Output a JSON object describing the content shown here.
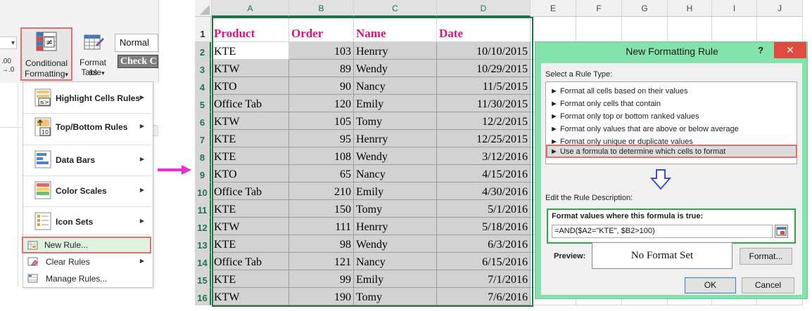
{
  "ribbon": {
    "cf_label_1": "Conditional",
    "cf_label_2": "Formatting",
    "fat_label_1": "Format as",
    "fat_label_2": "Table",
    "style_normal": "Normal",
    "style_check": "Check C",
    "dropdown_glyph": "▾",
    "stub_00": ".00",
    "stub_0": "→.0"
  },
  "cf_menu": {
    "items": [
      {
        "label": "Highlight Cells Rules",
        "icon": "highlight-cells-icon"
      },
      {
        "label": "Top/Bottom Rules",
        "icon": "top-bottom-icon"
      },
      {
        "label": "Data Bars",
        "icon": "data-bars-icon"
      },
      {
        "label": "Color Scales",
        "icon": "color-scales-icon"
      },
      {
        "label": "Icon Sets",
        "icon": "icon-sets-icon"
      }
    ],
    "new_rule": "New Rule...",
    "clear_rules": "Clear Rules",
    "manage_rules": "Manage Rules...",
    "submenu_arrow": "▶",
    "icon_text_lt": "≤>",
    "icon_text_10": "10"
  },
  "sheet": {
    "columns": [
      "A",
      "B",
      "C",
      "D",
      "E",
      "F",
      "G",
      "H",
      "I",
      "J"
    ],
    "row_numbers": [
      "1",
      "2",
      "3",
      "4",
      "5",
      "6",
      "7",
      "8",
      "9",
      "10",
      "11",
      "12",
      "13",
      "14",
      "15",
      "16"
    ],
    "headers": [
      "Product",
      "Order",
      "Name",
      "Date"
    ],
    "rows": [
      [
        "KTE",
        "103",
        "Henrry",
        "10/10/2015"
      ],
      [
        "KTW",
        "89",
        "Wendy",
        "10/29/2015"
      ],
      [
        "KTO",
        "90",
        "Nancy",
        "11/5/2015"
      ],
      [
        "Office Tab",
        "120",
        "Emily",
        "11/30/2015"
      ],
      [
        "KTW",
        "105",
        "Tomy",
        "12/2/2015"
      ],
      [
        "KTE",
        "95",
        "Henrry",
        "12/25/2015"
      ],
      [
        "KTE",
        "108",
        "Wendy",
        "3/12/2016"
      ],
      [
        "KTO",
        "65",
        "Nancy",
        "4/15/2016"
      ],
      [
        "Office Tab",
        "210",
        "Emily",
        "4/30/2016"
      ],
      [
        "KTE",
        "150",
        "Tomy",
        "5/1/2016"
      ],
      [
        "KTW",
        "111",
        "Henrry",
        "5/18/2016"
      ],
      [
        "KTE",
        "98",
        "Wendy",
        "6/3/2016"
      ],
      [
        "Office Tab",
        "121",
        "Nancy",
        "6/15/2016"
      ],
      [
        "KTE",
        "99",
        "Emily",
        "7/1/2016"
      ],
      [
        "KTW",
        "190",
        "Tomy",
        "7/6/2016"
      ]
    ],
    "header_color": "#e0107a",
    "shade_color": "#d2d2d2"
  },
  "dialog": {
    "title": "New Formatting Rule",
    "help": "?",
    "close": "✕",
    "select_rule_type": "Select a Rule Type:",
    "rule_types": [
      "Format all cells based on their values",
      "Format only cells that contain",
      "Format only top or bottom ranked values",
      "Format only values that are above or below average",
      "Format only unique or duplicate values",
      "Use a formula to determine which cells to format"
    ],
    "bullet": "►",
    "edit_rule_description": "Edit the Rule Description:",
    "format_values_label": "Format values where this formula is true:",
    "formula": "=AND($A2=\"KTE\", $B2>100)",
    "preview_label": "Preview:",
    "preview_text": "No Format Set",
    "format_button": "Format...",
    "ok_button": "OK",
    "cancel_button": "Cancel"
  }
}
